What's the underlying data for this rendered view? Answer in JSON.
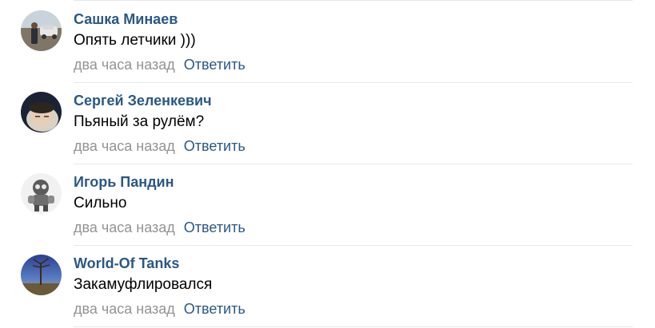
{
  "comments": [
    {
      "author": "Сашка Минаев",
      "text": "Опять летчики )))",
      "time": "два часа назад",
      "reply_label": "Ответить",
      "avatar_icon": "user-photo-car"
    },
    {
      "author": "Сергей Зеленкевич",
      "text": "Пьяный за рулём?",
      "time": "два часа назад",
      "reply_label": "Ответить",
      "avatar_icon": "user-photo-face"
    },
    {
      "author": "Игорь Пандин",
      "text": "Сильно",
      "time": "два часа назад",
      "reply_label": "Ответить",
      "avatar_icon": "user-photo-robot"
    },
    {
      "author": "World-Of Tanks",
      "text": "Закамуфлировался",
      "time": "два часа назад",
      "reply_label": "Ответить",
      "avatar_icon": "user-photo-landscape"
    }
  ],
  "colors": {
    "link": "#2a5885",
    "muted": "#939393",
    "text": "#000000",
    "divider": "#e7e8ec"
  }
}
